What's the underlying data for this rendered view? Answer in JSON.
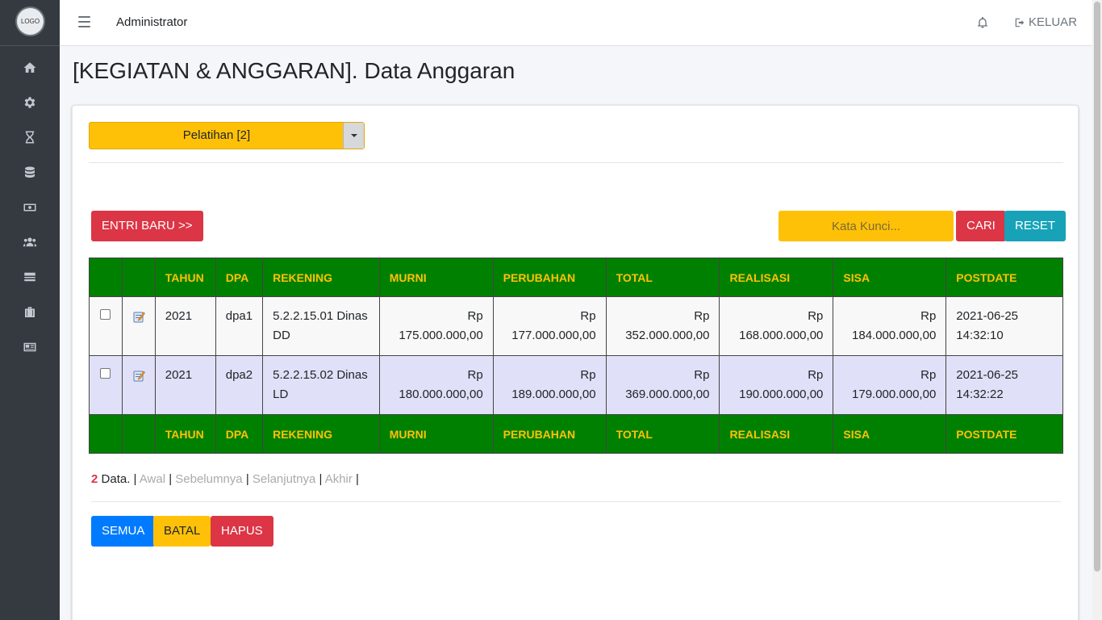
{
  "sidebar": {
    "logo_text": "LOGO",
    "icons": [
      "home-icon",
      "gear-icon",
      "hourglass-icon",
      "database-icon",
      "money-icon",
      "users-icon",
      "server-icon",
      "briefcase-icon",
      "newspaper-icon"
    ]
  },
  "topbar": {
    "title": "Administrator",
    "logout_label": "KELUAR"
  },
  "page": {
    "title": "[KEGIATAN & ANGGARAN]. Data Anggaran"
  },
  "filter": {
    "selected": "Pelatihan [2]"
  },
  "toolbar": {
    "new_label": "ENTRI BARU >>",
    "search_placeholder": "Kata Kunci...",
    "search_label": "CARI",
    "reset_label": "RESET"
  },
  "table": {
    "headers": [
      "",
      "",
      "TAHUN",
      "DPA",
      "REKENING",
      "MURNI",
      "PERUBAHAN",
      "TOTAL",
      "REALISASI",
      "SISA",
      "POSTDATE"
    ],
    "rows": [
      {
        "tahun": "2021",
        "dpa": "dpa1",
        "rekening": "5.2.2.15.01 Dinas DD",
        "murni": "Rp 175.000.000,00",
        "perubahan": "Rp 177.000.000,00",
        "total": "Rp 352.000.000,00",
        "realisasi": "Rp 168.000.000,00",
        "sisa": "Rp 184.000.000,00",
        "postdate": "2021-06-25 14:32:10"
      },
      {
        "tahun": "2021",
        "dpa": "dpa2",
        "rekening": "5.2.2.15.02 Dinas LD",
        "murni": "Rp 180.000.000,00",
        "perubahan": "Rp 189.000.000,00",
        "total": "Rp 369.000.000,00",
        "realisasi": "Rp 190.000.000,00",
        "sisa": "Rp 179.000.000,00",
        "postdate": "2021-06-25 14:32:22"
      }
    ]
  },
  "pager": {
    "count": "2",
    "data_label": "Data.",
    "first": "Awal",
    "prev": "Sebelumnya",
    "next": "Selanjutnya",
    "last": "Akhir"
  },
  "actions": {
    "all_label": "SEMUA",
    "cancel_label": "BATAL",
    "delete_label": "HAPUS"
  },
  "colors": {
    "sidebar": "#343a40",
    "table_header": "#008000",
    "table_header_text": "#ffc107",
    "accent_yellow": "#ffc107",
    "danger": "#dc3545",
    "info": "#17a2b8",
    "primary": "#007bff"
  }
}
